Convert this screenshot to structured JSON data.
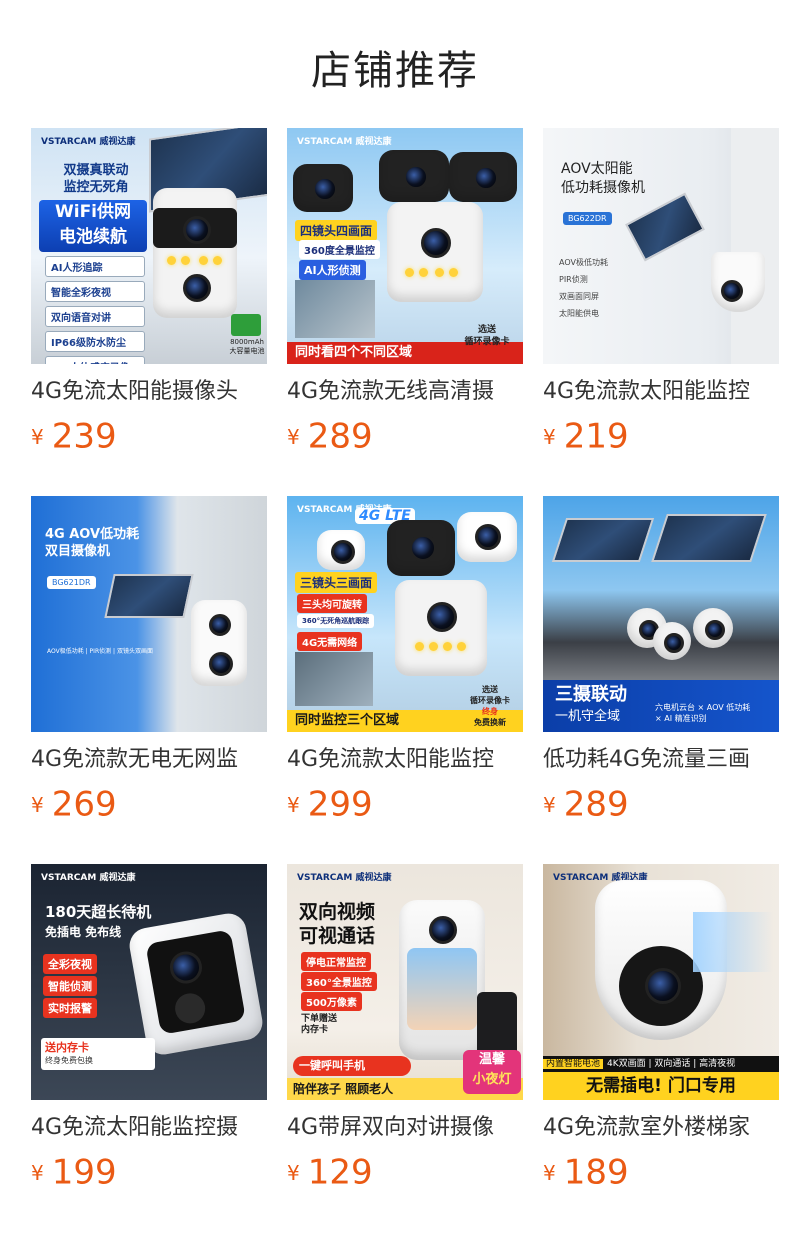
{
  "section_title": "店铺推荐",
  "currency": "¥",
  "products": [
    {
      "name": "4G免流太阳能摄像头",
      "price": "239",
      "art": {
        "brand": "VSTARCAM 威视达康",
        "headline": [
          "双摄真联动",
          "监控无死角"
        ],
        "wifi": [
          "WiFi供网",
          "电池续航"
        ],
        "features": [
          "AI人形追踪",
          "智能全彩夜视",
          "双向语音对讲",
          "IP66级防水防尘",
          "PIR人体感应录像"
        ],
        "battery": "8000mAh",
        "battery_sub": "大容量电池"
      }
    },
    {
      "name": "4G免流款无线高清摄",
      "price": "289",
      "art": {
        "brand": "VSTARCAM 威视达康",
        "tags": [
          "四镜头四画面",
          "360度全景监控",
          "AI人形侦测"
        ],
        "footer": "同时看四个不同区域",
        "badge": [
          "选送",
          "循环录像卡"
        ]
      }
    },
    {
      "name": "4G免流款太阳能监控",
      "price": "219",
      "art": {
        "headline": [
          "AOV太阳能",
          "低功耗摄像机"
        ],
        "model": "BG622DR",
        "features": [
          "AOV极低功耗",
          "PIR侦测",
          "双画面同屏",
          "太阳能供电"
        ]
      }
    },
    {
      "name": "4G免流款无电无网监",
      "price": "269",
      "art": {
        "headline": [
          "4G AOV低功耗",
          "双目摄像机"
        ],
        "model": "BG621DR",
        "caption": "AOV极低功耗 | PIR侦测 | 双镜头双画面"
      }
    },
    {
      "name": "4G免流款太阳能监控",
      "price": "299",
      "art": {
        "brand": "VSTARCAM 威视达康",
        "badge4g": "4G LTE",
        "tags": [
          "三镜头三画面",
          "三头均可旋转",
          "360°无死角巡航跟踪",
          "4G无需网络"
        ],
        "footer": "同时监控三个区域",
        "badge": [
          "选送",
          "循环录像卡",
          "终身",
          "免费换新"
        ]
      }
    },
    {
      "name": "低功耗4G免流量三画",
      "price": "289",
      "art": {
        "headline": [
          "三摄联动",
          "一机守全域"
        ],
        "features": [
          "六电机云台",
          "AOV 低功耗",
          "AI 精准识别"
        ]
      }
    },
    {
      "name": "4G免流太阳能监控摄",
      "price": "199",
      "art": {
        "brand": "VSTARCAM 威视达康",
        "headline": [
          "180天超长待机",
          "免插电 免布线"
        ],
        "tags": [
          "全彩夜视",
          "智能侦测",
          "实时报警"
        ],
        "gift": [
          "送内存卡",
          "终身免费包换"
        ]
      }
    },
    {
      "name": "4G带屏双向对讲摄像",
      "price": "129",
      "art": {
        "brand": "VSTARCAM 威视达康",
        "headline": [
          "双向视频",
          "可视通话"
        ],
        "tags": [
          "停电正常监控",
          "360°全景监控",
          "500万像素"
        ],
        "gift": [
          "下单赠送",
          "内存卡"
        ],
        "call": "一键呼叫手机",
        "footer": "陪伴孩子 照顾老人",
        "badge": [
          "温馨",
          "小夜灯"
        ]
      }
    },
    {
      "name": "4G免流款室外楼梯家",
      "price": "189",
      "art": {
        "brand": "VSTARCAM 威视达康",
        "strip_tag": "内置智能电池",
        "strip": "4K双画面 | 双向通话 | 高清夜视",
        "footer": "无需插电! 门口专用"
      }
    }
  ]
}
